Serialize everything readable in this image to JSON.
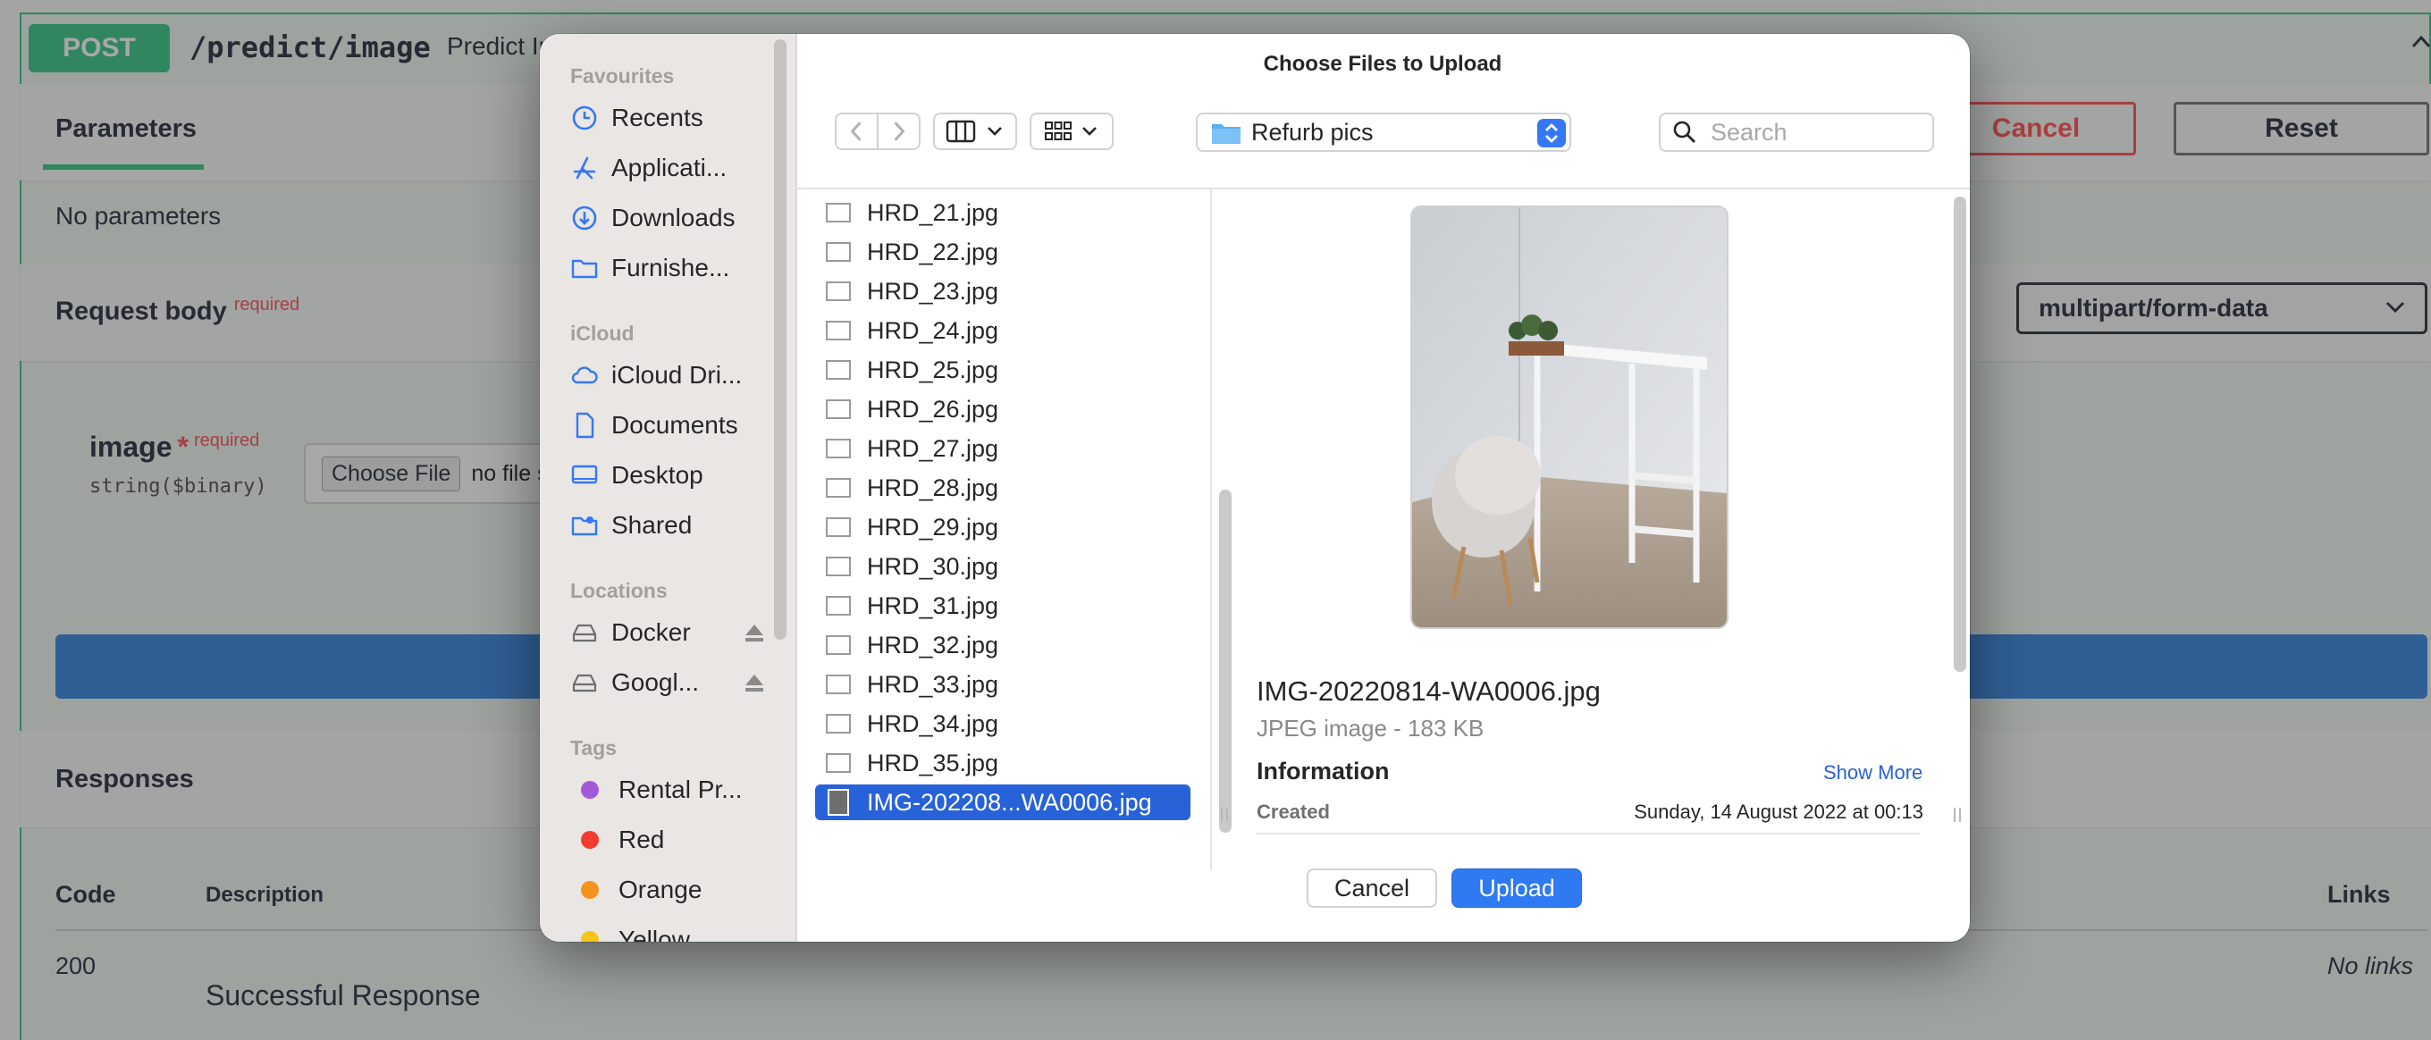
{
  "swagger": {
    "method": "POST",
    "path": "/predict/image",
    "summary": "Predict In",
    "params_tab": "Parameters",
    "cancel_label": "Cancel",
    "reset_label": "Reset",
    "no_params": "No parameters",
    "request_body": "Request body",
    "required": "required",
    "content_type": "multipart/form-data",
    "field_name": "image",
    "field_star": "*",
    "field_type": "string($binary)",
    "choose_file": "Choose File",
    "no_file": "no file s",
    "responses": "Responses",
    "col_code": "Code",
    "col_description": "Description",
    "col_links": "Links",
    "resp_code": "200",
    "resp_description": "Successful Response",
    "resp_links": "No links"
  },
  "dialog": {
    "title": "Choose Files to Upload",
    "folder": "Refurb pics",
    "search_placeholder": "Search",
    "cancel": "Cancel",
    "upload": "Upload"
  },
  "sidebar": {
    "favourites_heading": "Favourites",
    "favourites": [
      "Recents",
      "Applicati...",
      "Downloads",
      "Furnishe..."
    ],
    "icloud_heading": "iCloud",
    "icloud": [
      "iCloud Dri...",
      "Documents",
      "Desktop",
      "Shared"
    ],
    "locations_heading": "Locations",
    "locations": [
      "Docker",
      "Googl..."
    ],
    "tags_heading": "Tags",
    "tags": [
      {
        "label": "Rental Pr...",
        "color": "#a259d9"
      },
      {
        "label": "Red",
        "color": "#f23c30"
      },
      {
        "label": "Orange",
        "color": "#f5931f"
      },
      {
        "label": "Yellow",
        "color": "#f5c518"
      }
    ]
  },
  "files": [
    "HRD_21.jpg",
    "HRD_22.jpg",
    "HRD_23.jpg",
    "HRD_24.jpg",
    "HRD_25.jpg",
    "HRD_26.jpg",
    "HRD_27.jpg",
    "HRD_28.jpg",
    "HRD_29.jpg",
    "HRD_30.jpg",
    "HRD_31.jpg",
    "HRD_32.jpg",
    "HRD_33.jpg",
    "HRD_34.jpg",
    "HRD_35.jpg",
    "IMG-202208...WA0006.jpg"
  ],
  "selected_file_index": 15,
  "preview": {
    "name": "IMG-20220814-WA0006.jpg",
    "kind": "JPEG image - 183 KB",
    "info_heading": "Information",
    "show_more": "Show More",
    "created_label": "Created",
    "created_value": "Sunday, 14 August 2022 at 00:13"
  },
  "colors": {
    "accent_blue": "#2f79f2",
    "selection_blue": "#2862d8",
    "swagger_green": "#49cc90"
  }
}
